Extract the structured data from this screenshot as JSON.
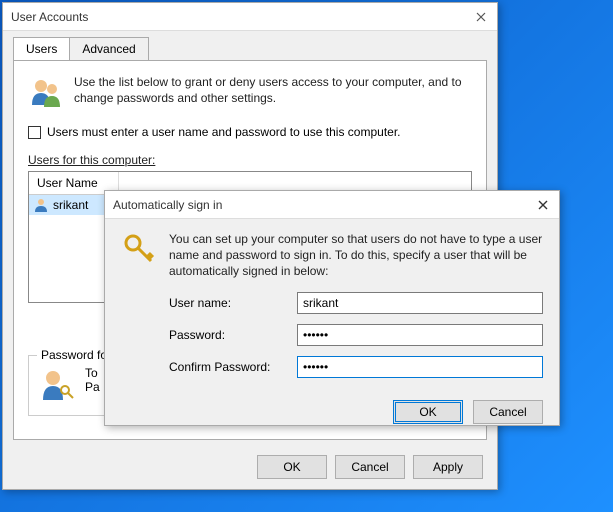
{
  "main": {
    "title": "User Accounts",
    "tabs": {
      "users": "Users",
      "advanced": "Advanced"
    },
    "intro": "Use the list below to grant or deny users access to your computer, and to change passwords and other settings.",
    "checkbox_label": "Users must enter a user name and password to use this computer.",
    "users_label": "Users for this computer:",
    "list_header_username": "User Name",
    "list_rows": [
      {
        "name": "srikant"
      }
    ],
    "password_group": "Password for",
    "password_lines": {
      "l1": "To",
      "l2": "Pa"
    },
    "buttons": {
      "ok": "OK",
      "cancel": "Cancel",
      "apply": "Apply"
    }
  },
  "modal": {
    "title": "Automatically sign in",
    "text": "You can set up your computer so that users do not have to type a user name and password to sign in. To do this, specify a user that will be automatically signed in below:",
    "labels": {
      "username": "User name:",
      "password": "Password:",
      "confirm": "Confirm Password:"
    },
    "values": {
      "username": "srikant",
      "password": "••••••",
      "confirm": "••••••"
    },
    "buttons": {
      "ok": "OK",
      "cancel": "Cancel"
    }
  }
}
